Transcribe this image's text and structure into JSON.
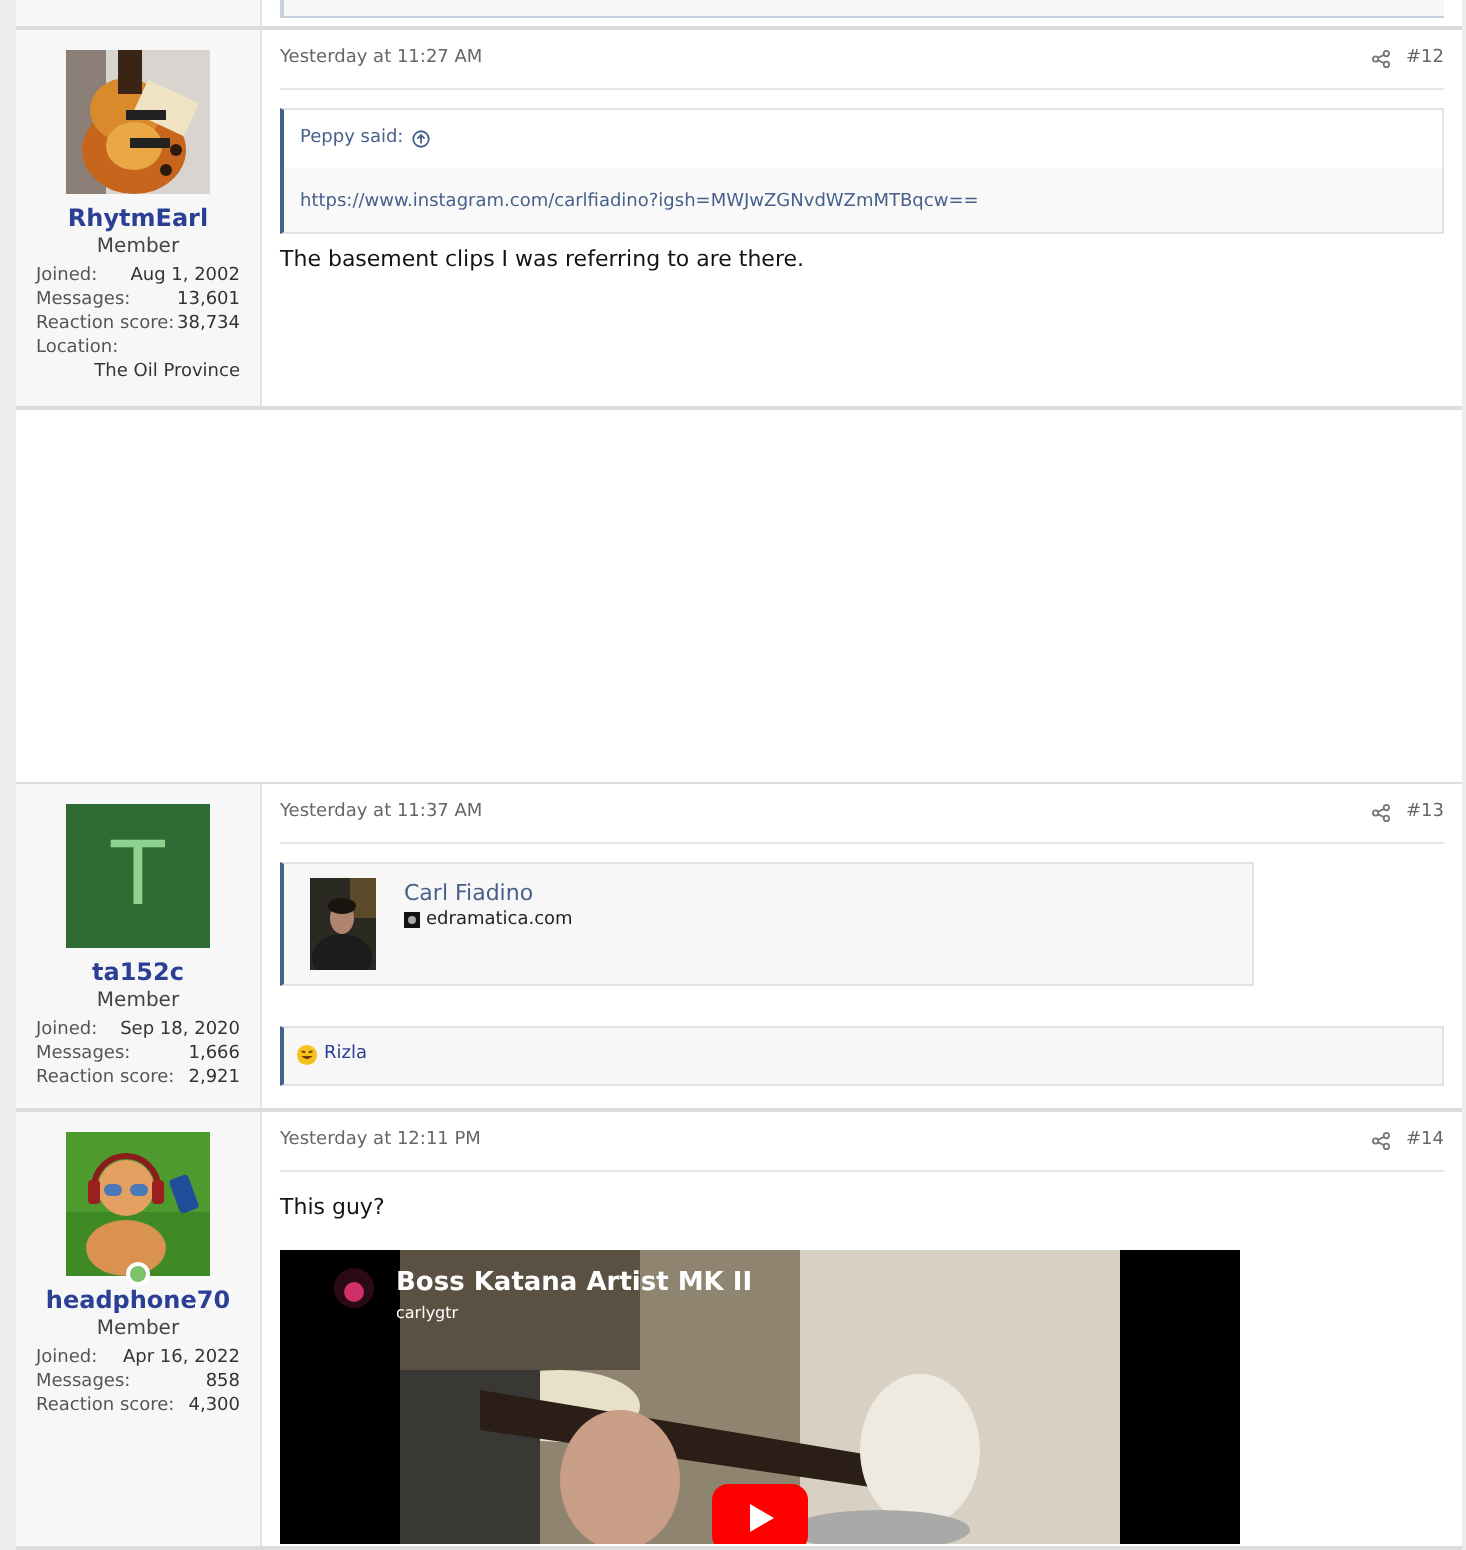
{
  "posts": [
    {
      "user": {
        "name": "RhytmEarl",
        "title": "Member",
        "online": false,
        "stats": [
          {
            "kind": "pair",
            "label": "Joined:",
            "value": "Aug 1, 2002"
          },
          {
            "kind": "pair",
            "label": "Messages:",
            "value": "13,601"
          },
          {
            "kind": "pair",
            "label": "Reaction score:",
            "value": "38,734"
          },
          {
            "kind": "stacked",
            "label": "Location:",
            "value": "The Oil Province"
          }
        ]
      },
      "date": "Yesterday at 11:27 AM",
      "number": "#12",
      "content": [
        {
          "kind": "quote",
          "author": "Peppy said:",
          "text": "https://www.instagram.com/carlfiadino?igsh=MWJwZGNvdWZmMTBqcw=="
        },
        {
          "kind": "text",
          "text": "The basement clips I was referring to are there."
        }
      ]
    },
    {
      "user": {
        "name": "ta152c",
        "title": "Member",
        "avatar": {
          "kind": "letter",
          "letter": "T",
          "color": "#2f6b32"
        },
        "online": false,
        "stats": [
          {
            "kind": "pair",
            "label": "Joined:",
            "value": "Sep 18, 2020"
          },
          {
            "kind": "pair",
            "label": "Messages:",
            "value": "1,666"
          },
          {
            "kind": "pair",
            "label": "Reaction score:",
            "value": "2,921"
          }
        ]
      },
      "date": "Yesterday at 11:37 AM",
      "number": "#13",
      "content": [
        {
          "kind": "link_card",
          "title": "Carl Fiadino",
          "site": "edramatica.com"
        }
      ],
      "reactions": "Rizla"
    },
    {
      "user": {
        "name": "headphone70",
        "title": "Member",
        "online": true,
        "stats": [
          {
            "kind": "pair",
            "label": "Joined:",
            "value": "Apr 16, 2022"
          },
          {
            "kind": "pair",
            "label": "Messages:",
            "value": "858"
          },
          {
            "kind": "pair",
            "label": "Reaction score:",
            "value": "4,300"
          }
        ]
      },
      "date": "Yesterday at 12:11 PM",
      "number": "#14",
      "content": [
        {
          "kind": "text",
          "text": "This guy?"
        },
        {
          "kind": "video",
          "title": "Boss Katana Artist MK II",
          "channel": "carlygtr"
        }
      ]
    }
  ]
}
